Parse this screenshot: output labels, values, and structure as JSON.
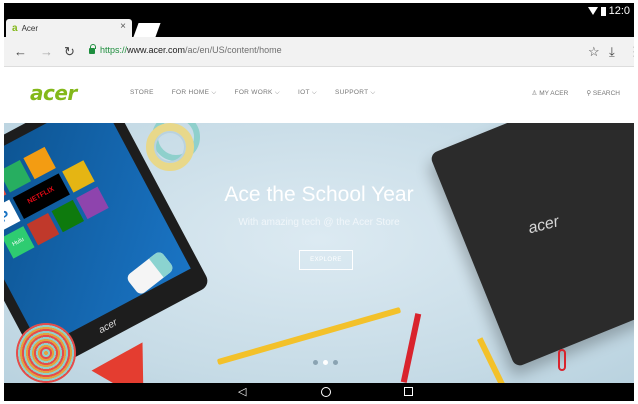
{
  "status": {
    "time": "12:0"
  },
  "browser": {
    "tab": {
      "favicon": "a",
      "title": "Acer",
      "close": "×"
    },
    "url_scheme": "https://",
    "url_host": "www.acer.com",
    "url_path": "/ac/en/US/content/home",
    "icons": [
      "back-arrow-icon",
      "forward-arrow-icon",
      "reload-icon",
      "lock-icon",
      "star-icon",
      "download-icon",
      "menu-icon"
    ]
  },
  "site": {
    "logo": "acer",
    "menu": [
      {
        "label": "STORE"
      },
      {
        "label": "FOR HOME ⌵"
      },
      {
        "label": "FOR WORK ⌵"
      },
      {
        "label": "IOT ⌵"
      },
      {
        "label": "SUPPORT ⌵"
      }
    ],
    "right_menu": [
      {
        "label": "MY ACER"
      },
      {
        "label": "SEARCH"
      }
    ]
  },
  "hero": {
    "title": "Ace the School Year",
    "subtitle": "With amazing tech @ the Acer Store",
    "button": "EXPLORE",
    "tablet_brand": "acer",
    "laptop_brand": "acer",
    "tile_labels": [
      "NETFLIX",
      "P",
      "Hulu"
    ],
    "carousel": {
      "count": 3,
      "active": 2
    }
  }
}
